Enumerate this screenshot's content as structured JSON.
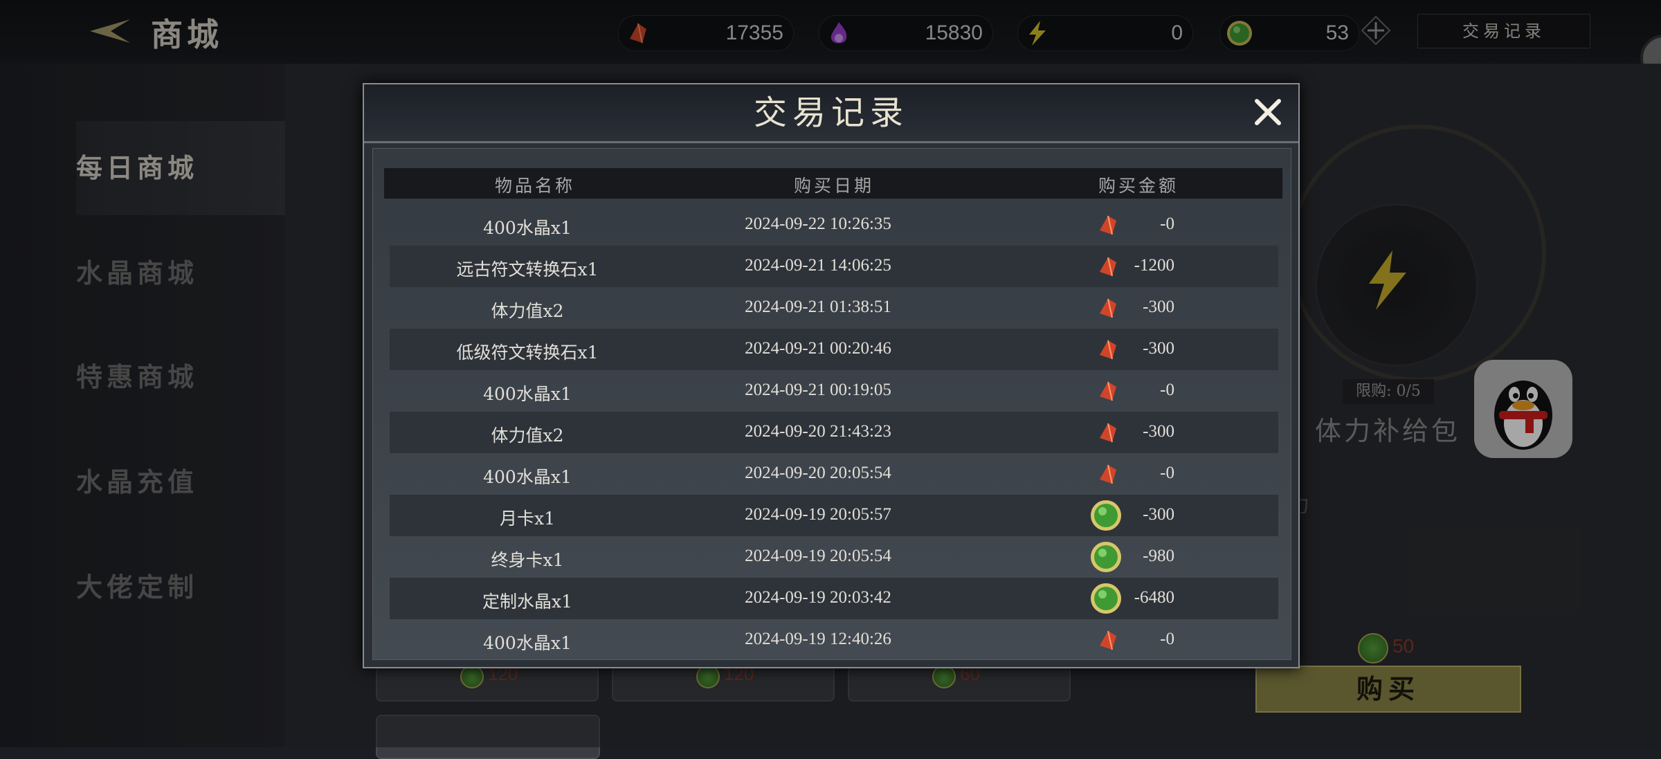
{
  "header": {
    "title": "商城",
    "currencies": [
      {
        "icon": "red-crystal-icon",
        "value": "17355"
      },
      {
        "icon": "purple-flame-icon",
        "value": "15830"
      },
      {
        "icon": "lightning-icon",
        "value": "0"
      },
      {
        "icon": "green-gem-icon",
        "value": "53"
      }
    ],
    "trade_record_button": "交易记录"
  },
  "sidebar": {
    "items": [
      {
        "label": "每日商城",
        "active": true
      },
      {
        "label": "水晶商城"
      },
      {
        "label": "特惠商城"
      },
      {
        "label": "水晶充值"
      },
      {
        "label": "大佬定制"
      }
    ]
  },
  "background_shop": {
    "card_prices": [
      "120",
      "120",
      "60"
    ],
    "limit": "限购: 0/5",
    "package_name": "体力补给包",
    "desc_fragment": "力",
    "price": "50",
    "buy_label": "购买"
  },
  "dialog": {
    "title": "交易记录",
    "columns": [
      "物品名称",
      "购买日期",
      "购买金额"
    ],
    "rows": [
      {
        "name": "400水晶x1",
        "date": "2024-09-22 10:26:35",
        "currency": "red",
        "amount": "-0"
      },
      {
        "name": "远古符文转换石x1",
        "date": "2024-09-21 14:06:25",
        "currency": "red",
        "amount": "-1200"
      },
      {
        "name": "体力值x2",
        "date": "2024-09-21 01:38:51",
        "currency": "red",
        "amount": "-300"
      },
      {
        "name": "低级符文转换石x1",
        "date": "2024-09-21 00:20:46",
        "currency": "red",
        "amount": "-300"
      },
      {
        "name": "400水晶x1",
        "date": "2024-09-21 00:19:05",
        "currency": "red",
        "amount": "-0"
      },
      {
        "name": "体力值x2",
        "date": "2024-09-20 21:43:23",
        "currency": "red",
        "amount": "-300"
      },
      {
        "name": "400水晶x1",
        "date": "2024-09-20 20:05:54",
        "currency": "red",
        "amount": "-0"
      },
      {
        "name": "月卡x1",
        "date": "2024-09-19 20:05:57",
        "currency": "green",
        "amount": "-300"
      },
      {
        "name": "终身卡x1",
        "date": "2024-09-19 20:05:54",
        "currency": "green",
        "amount": "-980"
      },
      {
        "name": "定制水晶x1",
        "date": "2024-09-19 20:03:42",
        "currency": "green",
        "amount": "-6480"
      },
      {
        "name": "400水晶x1",
        "date": "2024-09-19 12:40:26",
        "currency": "red",
        "amount": "-0"
      }
    ]
  },
  "colors": {
    "accent_gold": "#d8c98a",
    "price_red": "#8a3a2a",
    "buy_button": "#8a8448"
  }
}
